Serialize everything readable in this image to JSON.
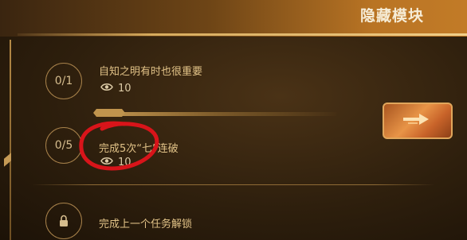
{
  "header": {
    "title": "隐藏模块"
  },
  "tasks": [
    {
      "progress": "0/1",
      "text": "自知之明有时也很重要",
      "views": "10"
    },
    {
      "progress": "0/5",
      "text": "完成5次“七”连破",
      "views": "10"
    }
  ],
  "locked_task": {
    "text": "完成上一个任务解锁"
  },
  "icons": {
    "views": "eye-icon",
    "lock": "lock-icon",
    "go": "arrow-right-icon"
  },
  "colors": {
    "accent": "#e1c287",
    "header_gradient_end": "#c27b27",
    "annotation": "#d8141a"
  }
}
